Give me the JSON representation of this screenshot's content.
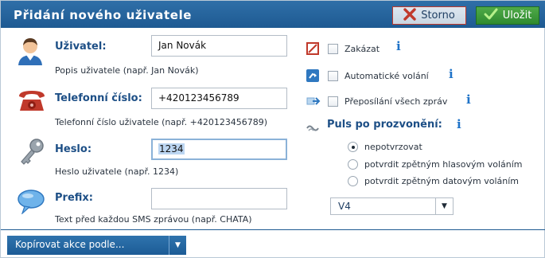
{
  "dialog": {
    "title": "Přidání nového uživatele",
    "cancel_label": "Storno",
    "save_label": "Uložit"
  },
  "fields": {
    "user": {
      "label": "Uživatel:",
      "value": "Jan Novák",
      "hint": "Popis uživatele (např. Jan Novák)"
    },
    "phone": {
      "label": "Telefonní číslo:",
      "value": "+420123456789",
      "hint": "Telefonní číslo uživatele (např. +420123456789)"
    },
    "password": {
      "label": "Heslo:",
      "value": "1234",
      "hint": "Heslo uživatele (např. 1234)"
    },
    "prefix": {
      "label": "Prefix:",
      "value": "",
      "hint": "Text před každou SMS zprávou (např. CHATA)"
    }
  },
  "options": {
    "forbid": {
      "label": "Zakázat",
      "checked": false
    },
    "auto_call": {
      "label": "Automatické volání",
      "checked": false
    },
    "forward_all": {
      "label": "Přeposílání všech zpráv",
      "checked": false
    }
  },
  "pulse": {
    "label": "Puls po prozvonění:",
    "options": [
      "nepotvrzovat",
      "potvrdit zpětným hlasovým voláním",
      "potvrdit zpětným datovým voláním"
    ],
    "selected_index": 0,
    "select_value": "V4"
  },
  "footer": {
    "copy_label": "Kopírovat akce podle..."
  },
  "icons": {
    "info": "i",
    "dropdown": "▼"
  },
  "colors": {
    "header": "#1e5a92",
    "label": "#1d4f86",
    "save": "#2f8a2f",
    "cancel_x": "#c0392b"
  }
}
